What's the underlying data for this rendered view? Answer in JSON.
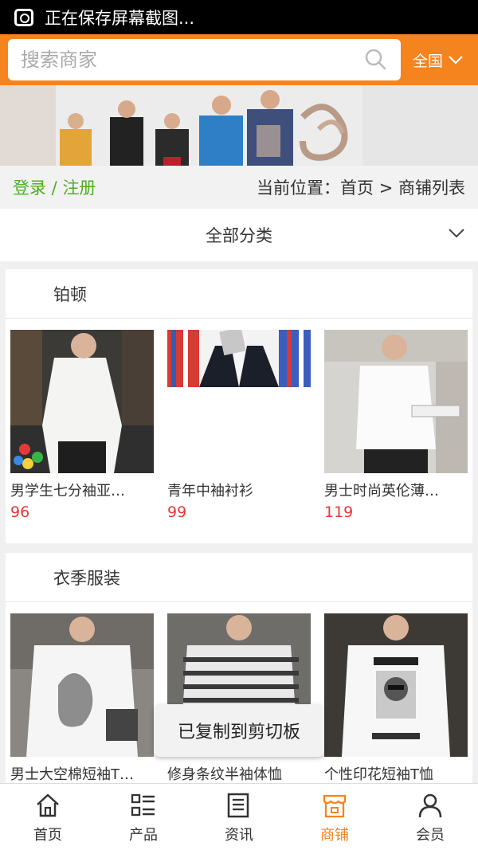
{
  "status_bar": {
    "text": "正在保存屏幕截图..."
  },
  "header": {
    "search_placeholder": "搜索商家",
    "region_label": "全国"
  },
  "breadcrumb_row": {
    "login_label": "登录",
    "separator": " / ",
    "register_label": "注册",
    "location_text": "当前位置：首页 > 商铺列表"
  },
  "category_filter": {
    "label": "全部分类"
  },
  "sections": [
    {
      "title": "铂顿",
      "products": [
        {
          "name": "男学生七分袖亚…",
          "price": "96"
        },
        {
          "name": "青年中袖衬衫",
          "price": "99"
        },
        {
          "name": "男士时尚英伦薄…",
          "price": "119"
        }
      ]
    },
    {
      "title": "衣季服装",
      "products": [
        {
          "name": "男士大空棉短袖T…",
          "price": ""
        },
        {
          "name": "修身条纹半袖体恤",
          "price": ""
        },
        {
          "name": "个性印花短袖T恤",
          "price": ""
        }
      ]
    }
  ],
  "toast": {
    "text": "已复制到剪切板"
  },
  "tab_bar": {
    "items": [
      {
        "label": "首页",
        "icon": "home-icon"
      },
      {
        "label": "产品",
        "icon": "list-icon"
      },
      {
        "label": "资讯",
        "icon": "news-icon"
      },
      {
        "label": "商铺",
        "icon": "shop-icon"
      },
      {
        "label": "会员",
        "icon": "user-icon"
      }
    ],
    "active_index": 3
  },
  "colors": {
    "accent": "#f5841f",
    "login_green": "#4caf24",
    "price_red": "#e53935"
  }
}
